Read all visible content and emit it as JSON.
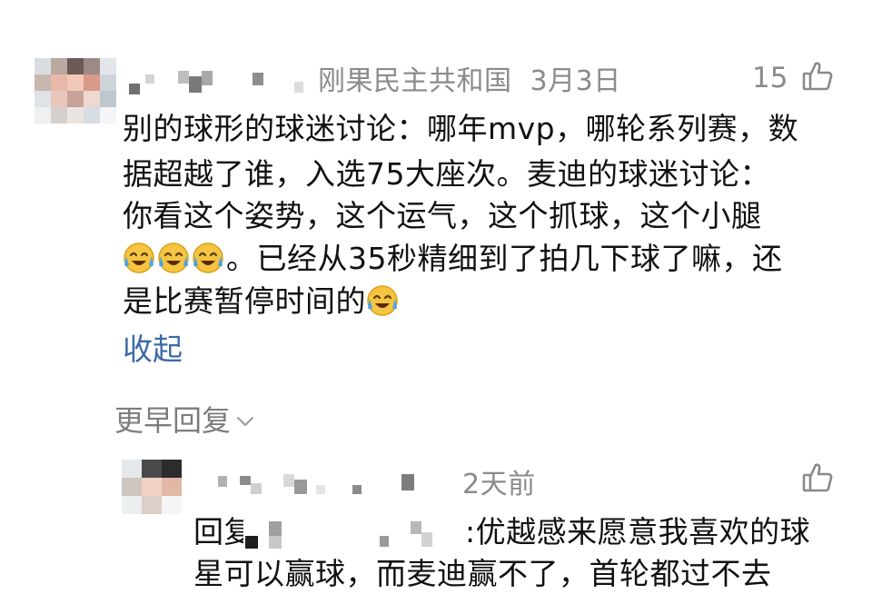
{
  "comment": {
    "location": "刚果民主共和国",
    "date": "3月3日",
    "like_count": "15",
    "lines": [
      "别的球形的球迷讨论：哪年mvp，哪轮系列赛，数",
      "据超越了谁，入选75大座次。麦迪的球迷讨论：",
      "你看这个姿势，这个运气，这个抓球，这个小腿",
      "。已经从35秒精细到了拍几下球了嘛，还",
      "是比赛暂停时间的"
    ],
    "collapse_label": "收起"
  },
  "earlier_replies_label": "更早回复",
  "reply": {
    "time": "2天前",
    "prefix": "回复",
    "text_end": ":优越感来愿意我喜欢的球",
    "line2": "星可以赢球，而麦迪赢不了，首轮都过不去"
  },
  "icons": {
    "like": "thumbs-up-icon",
    "emoji": "laughing-crying-emoji-icon",
    "expand": "chevron-down-icon"
  },
  "colors": {
    "link": "#3a6aa5",
    "meta": "#8a8a8a",
    "text": "#111111"
  }
}
